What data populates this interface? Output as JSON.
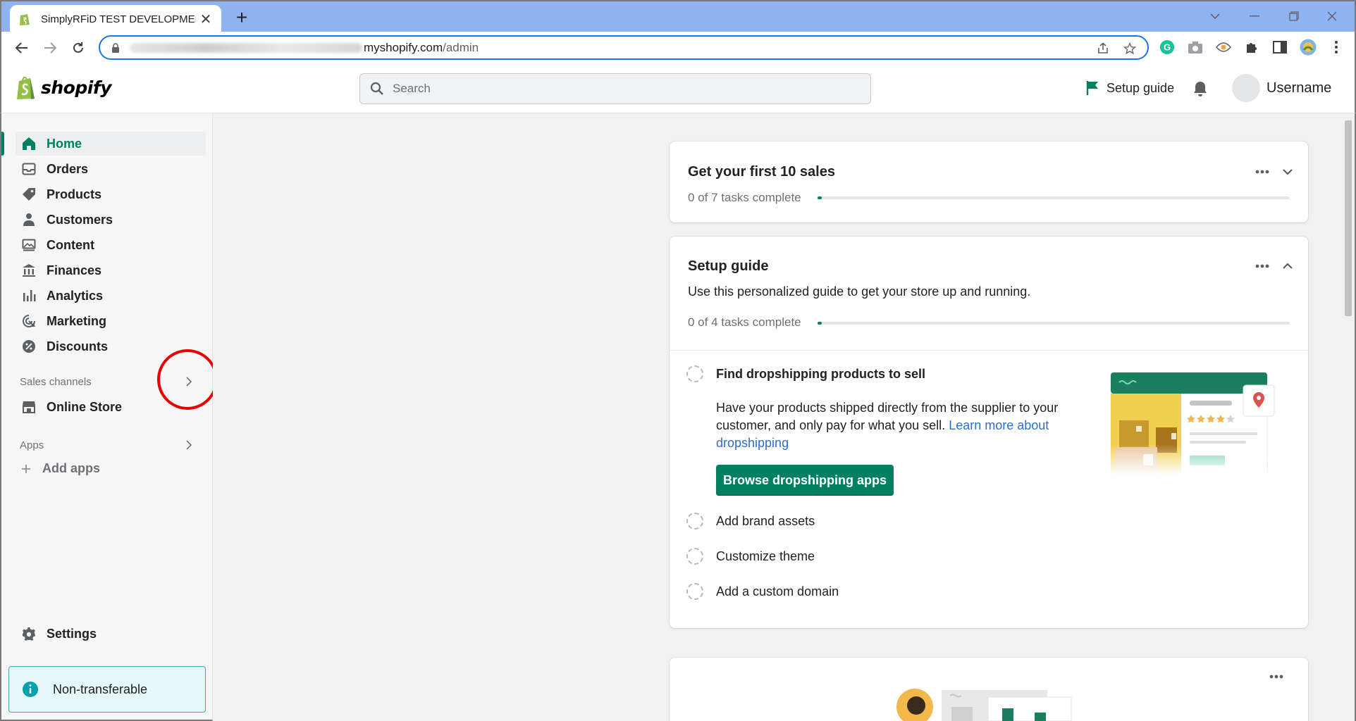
{
  "browser": {
    "tab_title": "SimplyRFiD TEST DEVELOPMENT",
    "tab_close": "✕",
    "new_tab": "+",
    "url_domain": "myshopify.com",
    "url_path": "/admin"
  },
  "topbar": {
    "logo_text": "shopify",
    "search_placeholder": "Search",
    "setup_guide": "Setup guide",
    "username": "Username"
  },
  "sidebar": {
    "items": [
      {
        "label": "Home",
        "icon": "home-icon"
      },
      {
        "label": "Orders",
        "icon": "inbox-icon"
      },
      {
        "label": "Products",
        "icon": "tag-icon"
      },
      {
        "label": "Customers",
        "icon": "person-icon"
      },
      {
        "label": "Content",
        "icon": "image-icon"
      },
      {
        "label": "Finances",
        "icon": "bank-icon"
      },
      {
        "label": "Analytics",
        "icon": "bar-chart-icon"
      },
      {
        "label": "Marketing",
        "icon": "target-icon"
      },
      {
        "label": "Discounts",
        "icon": "percent-icon"
      }
    ],
    "sales_channels_label": "Sales channels",
    "online_store": "Online Store",
    "apps_label": "Apps",
    "add_apps": "Add apps",
    "settings": "Settings",
    "non_transferable": "Non-transferable"
  },
  "cards": {
    "first_sales": {
      "title": "Get your first 10 sales",
      "progress_text": "0 of 7 tasks complete",
      "progress": 0
    },
    "setup_guide": {
      "title": "Setup guide",
      "description": "Use this personalized guide to get your store up and running.",
      "progress_text": "0 of 4 tasks complete",
      "progress": 0,
      "tasks": [
        {
          "label": "Find dropshipping products to sell",
          "body": "Have your products shipped directly from the supplier to your customer, and only pay for what you sell.",
          "link": "Learn more about dropshipping",
          "button": "Browse dropshipping apps"
        },
        {
          "label": "Add brand assets"
        },
        {
          "label": "Customize theme"
        },
        {
          "label": "Add a custom domain"
        }
      ]
    }
  },
  "colors": {
    "accent": "#008060",
    "link": "#2c6ecb",
    "annotation": "#e60000"
  }
}
